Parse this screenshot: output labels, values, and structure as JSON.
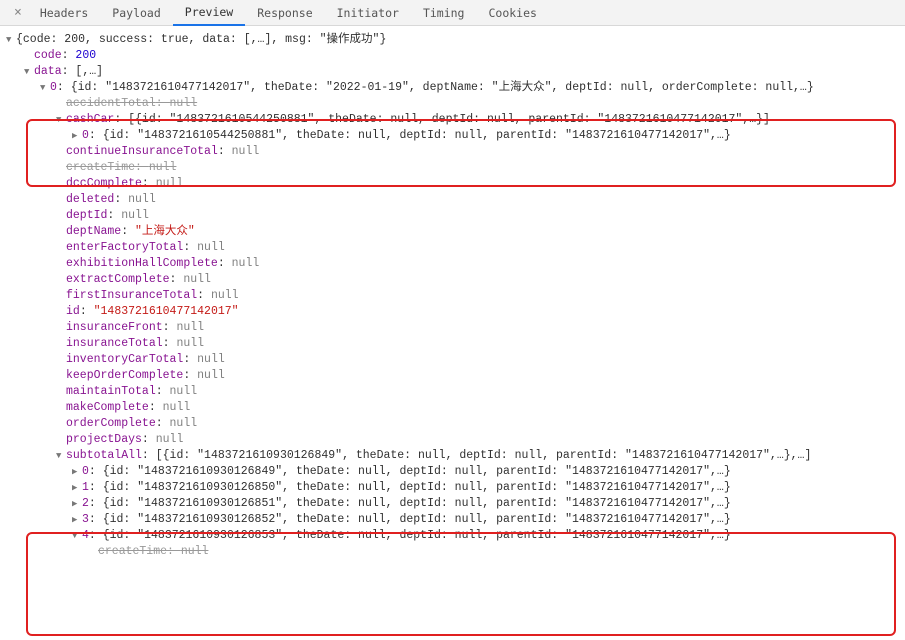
{
  "tabs": {
    "close": "×",
    "items": [
      "Headers",
      "Payload",
      "Preview",
      "Response",
      "Initiator",
      "Timing",
      "Cookies"
    ]
  },
  "caret_down": "▼",
  "caret_right": "▶",
  "root_summary": "{code: 200, success: true, data: [,…], msg: \"操作成功\"}",
  "code_key": "code",
  "code_val": "200",
  "data_key": "data",
  "data_summary": "[,…]",
  "item0_key": "0",
  "item0_summary": "{id: \"1483721610477142017\", theDate: \"2022-01-19\", deptName: \"上海大众\", deptId: null, orderComplete: null,…}",
  "accidentTotal_key": "accidentTotal",
  "accidentTotal_val": "null",
  "cashCar_key": "cashCar",
  "cashCar_summary": "[{id: \"1483721610544250881\", theDate: null, deptId: null, parentId: \"1483721610477142017\",…}]",
  "cashCar0_key": "0",
  "cashCar0_summary": "{id: \"1483721610544250881\", theDate: null, deptId: null, parentId: \"1483721610477142017\",…}",
  "continueInsuranceTotal_key": "continueInsuranceTotal",
  "continueInsuranceTotal_val": "null",
  "createTime_key": "createTime",
  "createTime_val": "null",
  "dccComplete_key": "dccComplete",
  "dccComplete_val": "null",
  "deleted_key": "deleted",
  "deleted_val": "null",
  "deptId_key": "deptId",
  "deptId_val": "null",
  "deptName_key": "deptName",
  "deptName_val": "\"上海大众\"",
  "enterFactoryTotal_key": "enterFactoryTotal",
  "enterFactoryTotal_val": "null",
  "exhibitionHallComplete_key": "exhibitionHallComplete",
  "exhibitionHallComplete_val": "null",
  "extractComplete_key": "extractComplete",
  "extractComplete_val": "null",
  "firstInsuranceTotal_key": "firstInsuranceTotal",
  "firstInsuranceTotal_val": "null",
  "id_key": "id",
  "id_val": "\"1483721610477142017\"",
  "insuranceFront_key": "insuranceFront",
  "insuranceFront_val": "null",
  "insuranceTotal_key": "insuranceTotal",
  "insuranceTotal_val": "null",
  "inventoryCarTotal_key": "inventoryCarTotal",
  "inventoryCarTotal_val": "null",
  "keepOrderComplete_key": "keepOrderComplete",
  "keepOrderComplete_val": "null",
  "maintainTotal_key": "maintainTotal",
  "maintainTotal_val": "null",
  "makeComplete_key": "makeComplete",
  "makeComplete_val": "null",
  "orderComplete_key": "orderComplete",
  "orderComplete_val": "null",
  "projectDays_key": "projectDays",
  "projectDays_val": "null",
  "subtotalAll_key": "subtotalAll",
  "subtotalAll_summary": "[{id: \"1483721610930126849\", theDate: null, deptId: null, parentId: \"1483721610477142017\",…},…]",
  "sub0_key": "0",
  "sub0_val": "{id: \"1483721610930126849\", theDate: null, deptId: null, parentId: \"1483721610477142017\",…}",
  "sub1_key": "1",
  "sub1_val": "{id: \"1483721610930126850\", theDate: null, deptId: null, parentId: \"1483721610477142017\",…}",
  "sub2_key": "2",
  "sub2_val": "{id: \"1483721610930126851\", theDate: null, deptId: null, parentId: \"1483721610477142017\",…}",
  "sub3_key": "3",
  "sub3_val": "{id: \"1483721610930126852\", theDate: null, deptId: null, parentId: \"1483721610477142017\",…}",
  "sub4_key": "4",
  "sub4_val": "{id: \"1483721610930126853\", theDate: null, deptId: null, parentId: \"1483721610477142017\",…}",
  "createTime2_key": "createTime",
  "createTime2_val": "null"
}
